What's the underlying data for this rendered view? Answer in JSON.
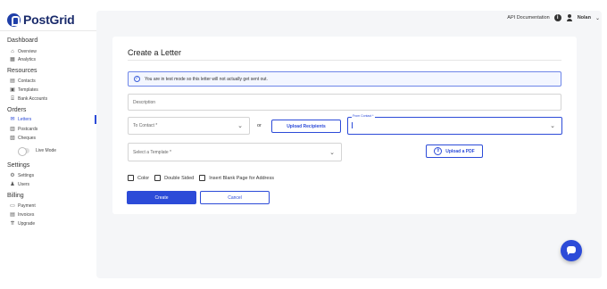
{
  "app": {
    "logo_text": "PostGrid"
  },
  "topbar": {
    "api_docs": "API Documentation",
    "user_name": "Nolan"
  },
  "sidebar": {
    "dashboard_title": "Dashboard",
    "dashboard_items": [
      {
        "label": "Overview",
        "icon": "home-icon"
      },
      {
        "label": "Analytics",
        "icon": "analytics-icon"
      }
    ],
    "resources_title": "Resources",
    "resources_items": [
      {
        "label": "Contacts",
        "icon": "contacts-icon"
      },
      {
        "label": "Templates",
        "icon": "templates-icon"
      },
      {
        "label": "Bank Accounts",
        "icon": "bank-icon"
      }
    ],
    "orders_title": "Orders",
    "orders_items": [
      {
        "label": "Letters",
        "icon": "letters-icon",
        "active": true
      },
      {
        "label": "Postcards",
        "icon": "postcards-icon"
      },
      {
        "label": "Cheques",
        "icon": "cheques-icon"
      }
    ],
    "live_mode_label": "Live Mode",
    "settings_title": "Settings",
    "settings_items": [
      {
        "label": "Settings",
        "icon": "gear-icon"
      },
      {
        "label": "Users",
        "icon": "users-icon"
      }
    ],
    "billing_title": "Billing",
    "billing_items": [
      {
        "label": "Payment",
        "icon": "payment-icon"
      },
      {
        "label": "Invoices",
        "icon": "invoices-icon"
      },
      {
        "label": "Upgrade",
        "icon": "upgrade-icon"
      }
    ]
  },
  "form": {
    "title": "Create a Letter",
    "alert_text": "You are in test mode so this letter will not actually get sent out.",
    "description_placeholder": "Description",
    "to_contact_placeholder": "To Contact *",
    "or_label": "or",
    "upload_recipients_label": "Upload Recipients",
    "from_contact_label": "From Contact *",
    "template_placeholder": "Select a Template *",
    "upload_pdf_label": "Upload a PDF",
    "checkbox_color": "Color",
    "checkbox_double_sided": "Double Sided",
    "checkbox_blank_page": "Insert Blank Page for Address",
    "create_label": "Create",
    "cancel_label": "Cancel"
  },
  "colors": {
    "accent": "#2c4bd8",
    "brand": "#1a2b6b",
    "background": "#f5f6f8"
  }
}
